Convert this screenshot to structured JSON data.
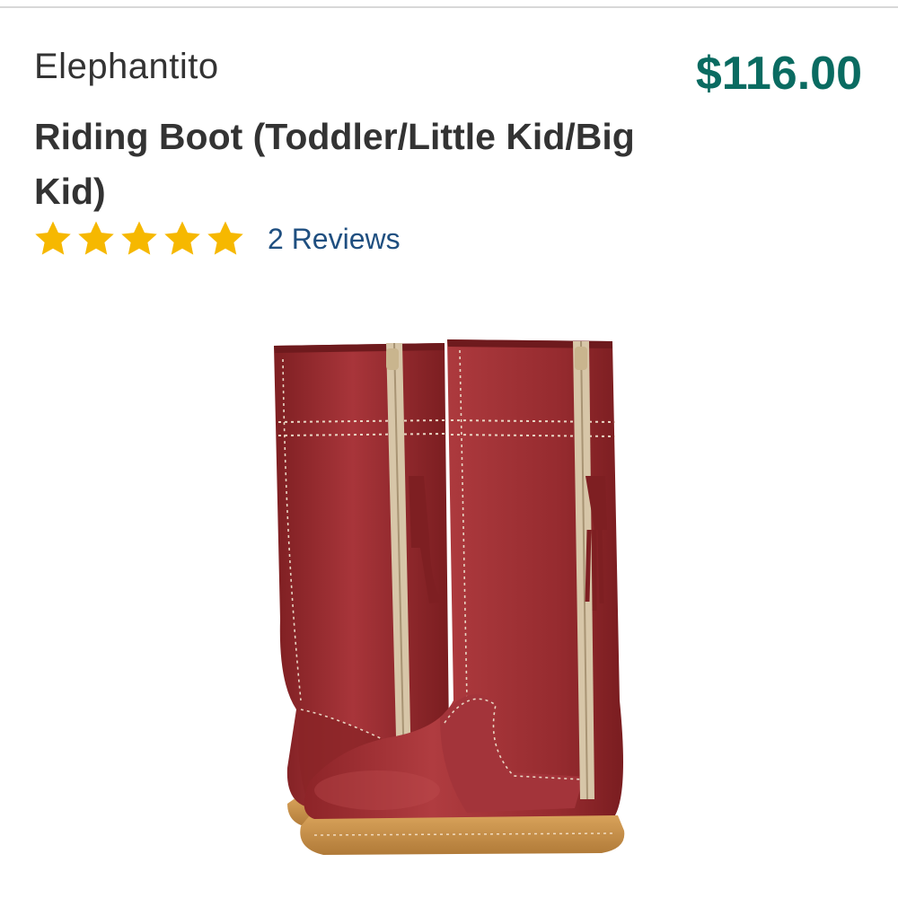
{
  "product": {
    "brand": "Elephantito",
    "price": "$116.00",
    "title": "Riding Boot (Toddler/Little Kid/Big Kid)",
    "rating": {
      "value": 5,
      "max": 5
    },
    "reviews_label": "2 Reviews"
  },
  "colors": {
    "price": "#0a6b61",
    "star": "#f6b800",
    "reviews_link": "#1f4f80",
    "boot_leather": "#9b2a2c"
  },
  "icons": {
    "star": "star-icon"
  }
}
